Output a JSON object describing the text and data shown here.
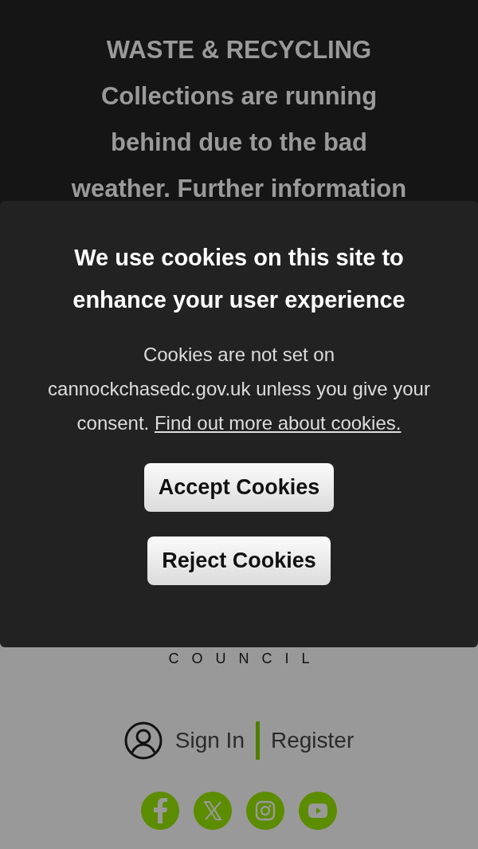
{
  "banner": {
    "heading": "WASTE & RECYCLING",
    "text": "Collections are running behind due to the bad weather. Further information"
  },
  "logo_text": "COUNCIL",
  "account": {
    "sign_in": "Sign In",
    "register": "Register"
  },
  "social": [
    {
      "kind": "facebook"
    },
    {
      "kind": "x"
    },
    {
      "kind": "instagram"
    },
    {
      "kind": "youtube"
    }
  ],
  "cookie_banner": {
    "title": "We use cookies on this site to enhance your user experience",
    "text": "Cookies are not set on cannockchasedc.gov.uk unless you give your consent.",
    "link": "Find out more about cookies.",
    "buttons": [
      "Accept Cookies",
      "Reject Cookies"
    ]
  }
}
